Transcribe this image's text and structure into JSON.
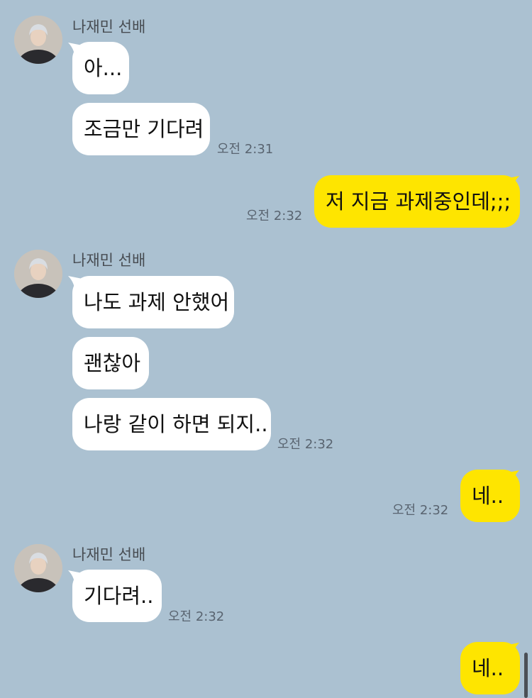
{
  "chat": {
    "sender_name": "나재민 선배",
    "groups": [
      {
        "direction": "in",
        "sender": "나재민 선배",
        "messages": [
          "아...",
          "조금만 기다려"
        ],
        "time": "오전 2:31"
      },
      {
        "direction": "out",
        "messages": [
          "저 지금 과제중인데;;;"
        ],
        "time": "오전 2:32"
      },
      {
        "direction": "in",
        "sender": "나재민 선배",
        "messages": [
          "나도 과제 안했어",
          "괜찮아",
          "나랑 같이 하면 되지.."
        ],
        "time": "오전 2:32"
      },
      {
        "direction": "out",
        "messages": [
          "네.."
        ],
        "time": "오전 2:32"
      },
      {
        "direction": "in",
        "sender": "나재민 선배",
        "messages": [
          "기다려.."
        ],
        "time": "오전 2:32"
      },
      {
        "direction": "out",
        "messages": [
          "네.."
        ]
      }
    ]
  },
  "colors": {
    "background": "#abc1d1",
    "incoming_bubble": "#ffffff",
    "outgoing_bubble": "#fee500",
    "timestamp": "#596470"
  },
  "icons": {
    "avatar": "profile-photo"
  }
}
